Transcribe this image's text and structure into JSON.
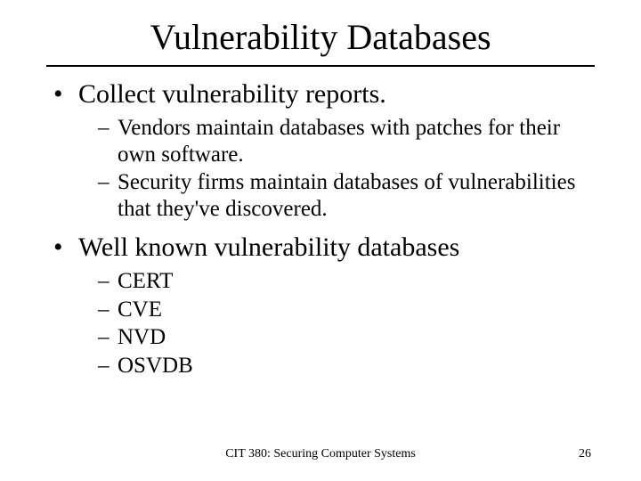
{
  "title": "Vulnerability Databases",
  "bullets": [
    {
      "text": "Collect vulnerability reports.",
      "subs": [
        "Vendors maintain databases with patches for their own software.",
        "Security firms maintain databases of vulnerabilities that they've discovered."
      ]
    },
    {
      "text": "Well known vulnerability databases",
      "subs": [
        "CERT",
        "CVE",
        "NVD",
        "OSVDB"
      ]
    }
  ],
  "footer": {
    "center": "CIT 380: Securing Computer Systems",
    "pageNumber": "26"
  }
}
